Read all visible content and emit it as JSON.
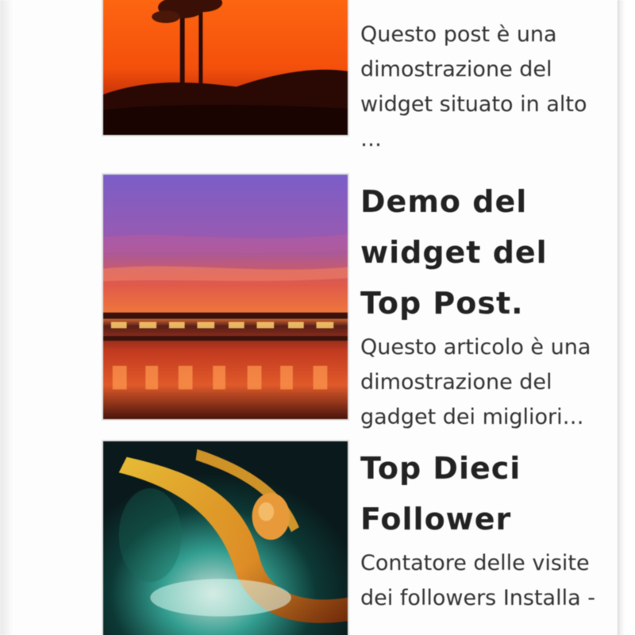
{
  "widget": {
    "posts": [
      {
        "title": "",
        "snippet": "Questo post è una dimostrazione del widget situato in alto …",
        "image_icon": "sunset-palm-trees-image"
      },
      {
        "title": "Demo del widget del Top Post.",
        "snippet": "Questo articolo è una dimostrazione del gadget dei migliori…",
        "image_icon": "sunset-pier-image"
      },
      {
        "title": "Top Dieci Follower",
        "snippet": "Contatore delle visite dei followers Installa -",
        "image_icon": "abstract-space-swirl-image"
      }
    ]
  }
}
